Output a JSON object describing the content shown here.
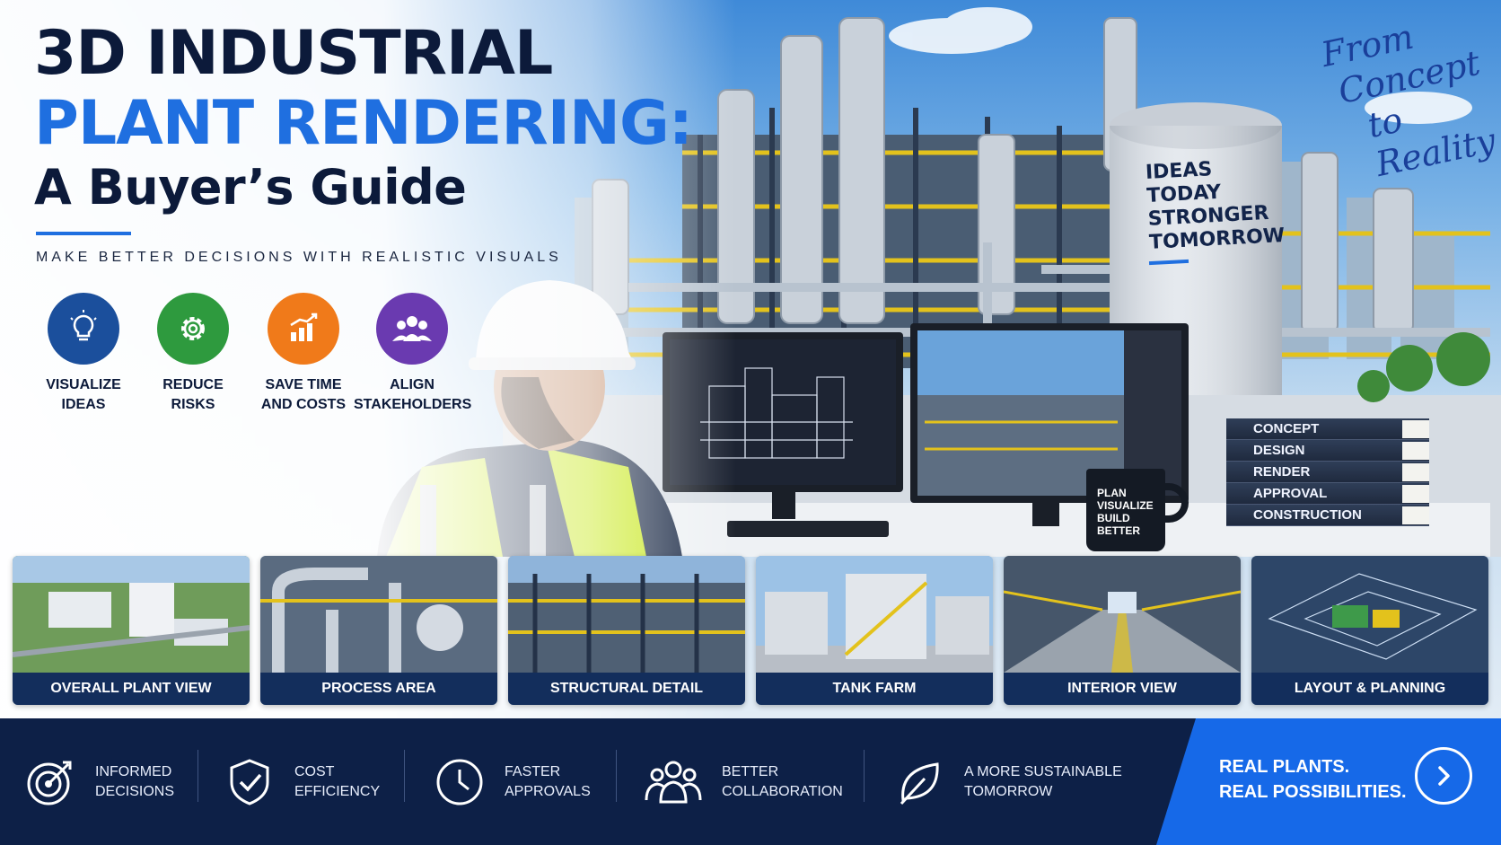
{
  "title": {
    "line1": "3D INDUSTRIAL",
    "line2": "PLANT RENDERING:",
    "line3": "A Buyer’s Guide",
    "subtitle": "MAKE BETTER DECISIONS WITH REALISTIC VISUALS"
  },
  "benefits": [
    {
      "icon": "lightbulb-icon",
      "color": "#1b4f9c",
      "line1": "VISUALIZE",
      "line2": "IDEAS"
    },
    {
      "icon": "gear-icon",
      "color": "#2e9a3e",
      "line1": "REDUCE",
      "line2": "RISKS"
    },
    {
      "icon": "growth-chart-icon",
      "color": "#f07a1a",
      "line1": "SAVE TIME",
      "line2": "AND COSTS"
    },
    {
      "icon": "people-group-icon",
      "color": "#6a3ab0",
      "line1": "ALIGN",
      "line2": "STAKEHOLDERS"
    }
  ],
  "script_tagline": {
    "line1": "From",
    "line2": "Concept",
    "line3": "to Reality"
  },
  "tank_text": {
    "line1": "IDEAS",
    "line2": "TODAY",
    "line3": "STRONGER",
    "line4": "TOMORROW"
  },
  "binders": [
    "CONCEPT",
    "DESIGN",
    "RENDER",
    "APPROVAL",
    "CONSTRUCTION"
  ],
  "mug_text": {
    "line1": "PLAN",
    "line2": "VISUALIZE",
    "line3": "BUILD",
    "line4": "BETTER"
  },
  "thumbnails": [
    {
      "caption": "OVERALL PLANT VIEW"
    },
    {
      "caption": "PROCESS AREA"
    },
    {
      "caption": "STRUCTURAL DETAIL"
    },
    {
      "caption": "TANK FARM"
    },
    {
      "caption": "INTERIOR VIEW"
    },
    {
      "caption": "LAYOUT & PLANNING"
    }
  ],
  "features": [
    {
      "icon": "target-icon",
      "line1": "INFORMED",
      "line2": "DECISIONS"
    },
    {
      "icon": "shield-check-icon",
      "line1": "COST",
      "line2": "EFFICIENCY"
    },
    {
      "icon": "clock-icon",
      "line1": "FASTER",
      "line2": "APPROVALS"
    },
    {
      "icon": "team-icon",
      "line1": "BETTER",
      "line2": "COLLABORATION"
    },
    {
      "icon": "leaf-icon",
      "line1": "A MORE SUSTAINABLE",
      "line2": "TOMORROW"
    }
  ],
  "cta": {
    "line1": "REAL PLANTS.",
    "line2": "REAL POSSIBILITIES.",
    "icon": "chevron-right-icon"
  },
  "colors": {
    "navy": "#0d2047",
    "brand_blue": "#1f6fe0",
    "cta_blue": "#1669e8",
    "safety_yellow": "#e3c21c"
  }
}
